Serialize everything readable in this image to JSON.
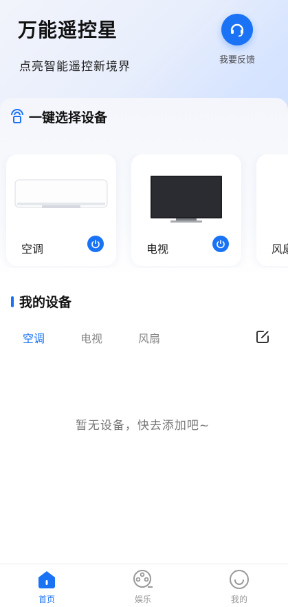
{
  "header": {
    "title": "万能遥控星",
    "subtitle": "点亮智能遥控新境界",
    "feedback_label": "我要反馈"
  },
  "quick_select": {
    "title": "一键选择设备",
    "devices": [
      {
        "name": "空调",
        "icon": "air-conditioner-image"
      },
      {
        "name": "电视",
        "icon": "tv-image"
      },
      {
        "name": "风扇",
        "icon": "fan-image"
      }
    ]
  },
  "my_devices": {
    "title": "我的设备",
    "tabs": [
      {
        "label": "空调",
        "active": true
      },
      {
        "label": "电视",
        "active": false
      },
      {
        "label": "风扇",
        "active": false
      }
    ],
    "empty_message": "暂无设备，快去添加吧~"
  },
  "bottom_nav": [
    {
      "label": "首页",
      "icon": "home-icon",
      "active": true
    },
    {
      "label": "娱乐",
      "icon": "entertainment-icon",
      "active": false
    },
    {
      "label": "我的",
      "icon": "profile-smile-icon",
      "active": false
    }
  ],
  "colors": {
    "accent": "#1a73f5",
    "inactive_text": "#888888"
  }
}
